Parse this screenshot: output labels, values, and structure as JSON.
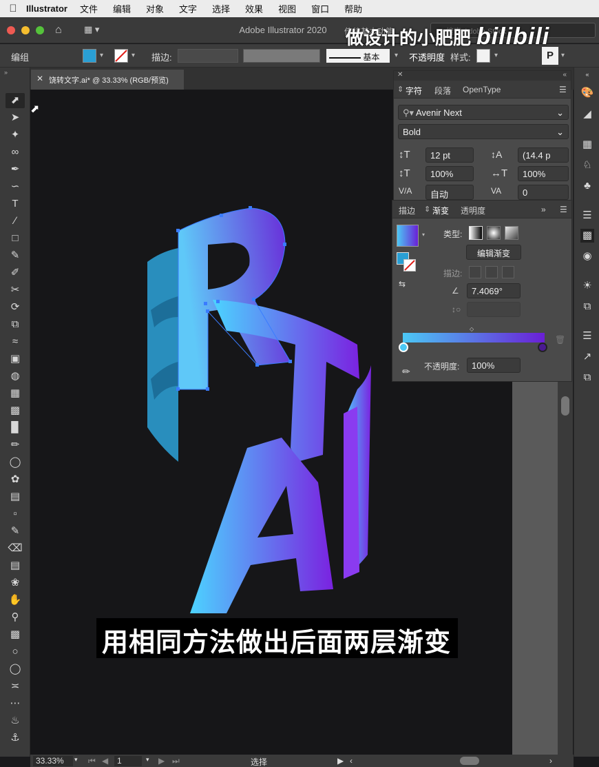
{
  "menubar": {
    "app_name": "Illustrator",
    "items": [
      "文件",
      "编辑",
      "对象",
      "文字",
      "选择",
      "效果",
      "视图",
      "窗口",
      "帮助"
    ]
  },
  "titlebar": {
    "title": "Adobe Illustrator 2020",
    "workspace": "传统基本功能",
    "search_placeholder": "搜索 Adobe Stock"
  },
  "controlbar": {
    "selection_label": "编组",
    "fill_color": "#2a9fd4",
    "stroke_label": "描边:",
    "stroke_profile": "基本",
    "opacity_label": "不透明度",
    "style_label": "样式:"
  },
  "document_tab": {
    "name": "饶转文字.ai* @ 33.33% (RGB/预览)"
  },
  "character_panel": {
    "tabs": [
      "字符",
      "段落",
      "OpenType"
    ],
    "font_family": "Avenir Next",
    "font_style": "Bold",
    "font_size": "12 pt",
    "leading": "(14.4 p",
    "vertical_scale": "100%",
    "horizontal_scale": "100%",
    "kerning": "自动",
    "tracking": "0"
  },
  "gradient_panel": {
    "tabs": [
      "描边",
      "渐变",
      "透明度"
    ],
    "type_label": "类型:",
    "edit_gradient": "编辑渐变",
    "stroke_label": "描边:",
    "angle": "7.4069°",
    "opacity_label": "不透明度:",
    "opacity": "100%",
    "stop_start_color": "#4cc8f5",
    "stop_end_color": "#6a1fd6"
  },
  "artwork": {
    "letters": [
      "R",
      "T",
      "A",
      "I"
    ],
    "gradient_start": "#4cd3ff",
    "gradient_end": "#7a22e0"
  },
  "statusbar": {
    "zoom": "33.33%",
    "artboard": "1",
    "mode": "选择"
  },
  "subtitle": "用相同方法做出后面两层渐变",
  "watermark": {
    "text": "做设计的小肥肥",
    "brand": "bilibili"
  }
}
